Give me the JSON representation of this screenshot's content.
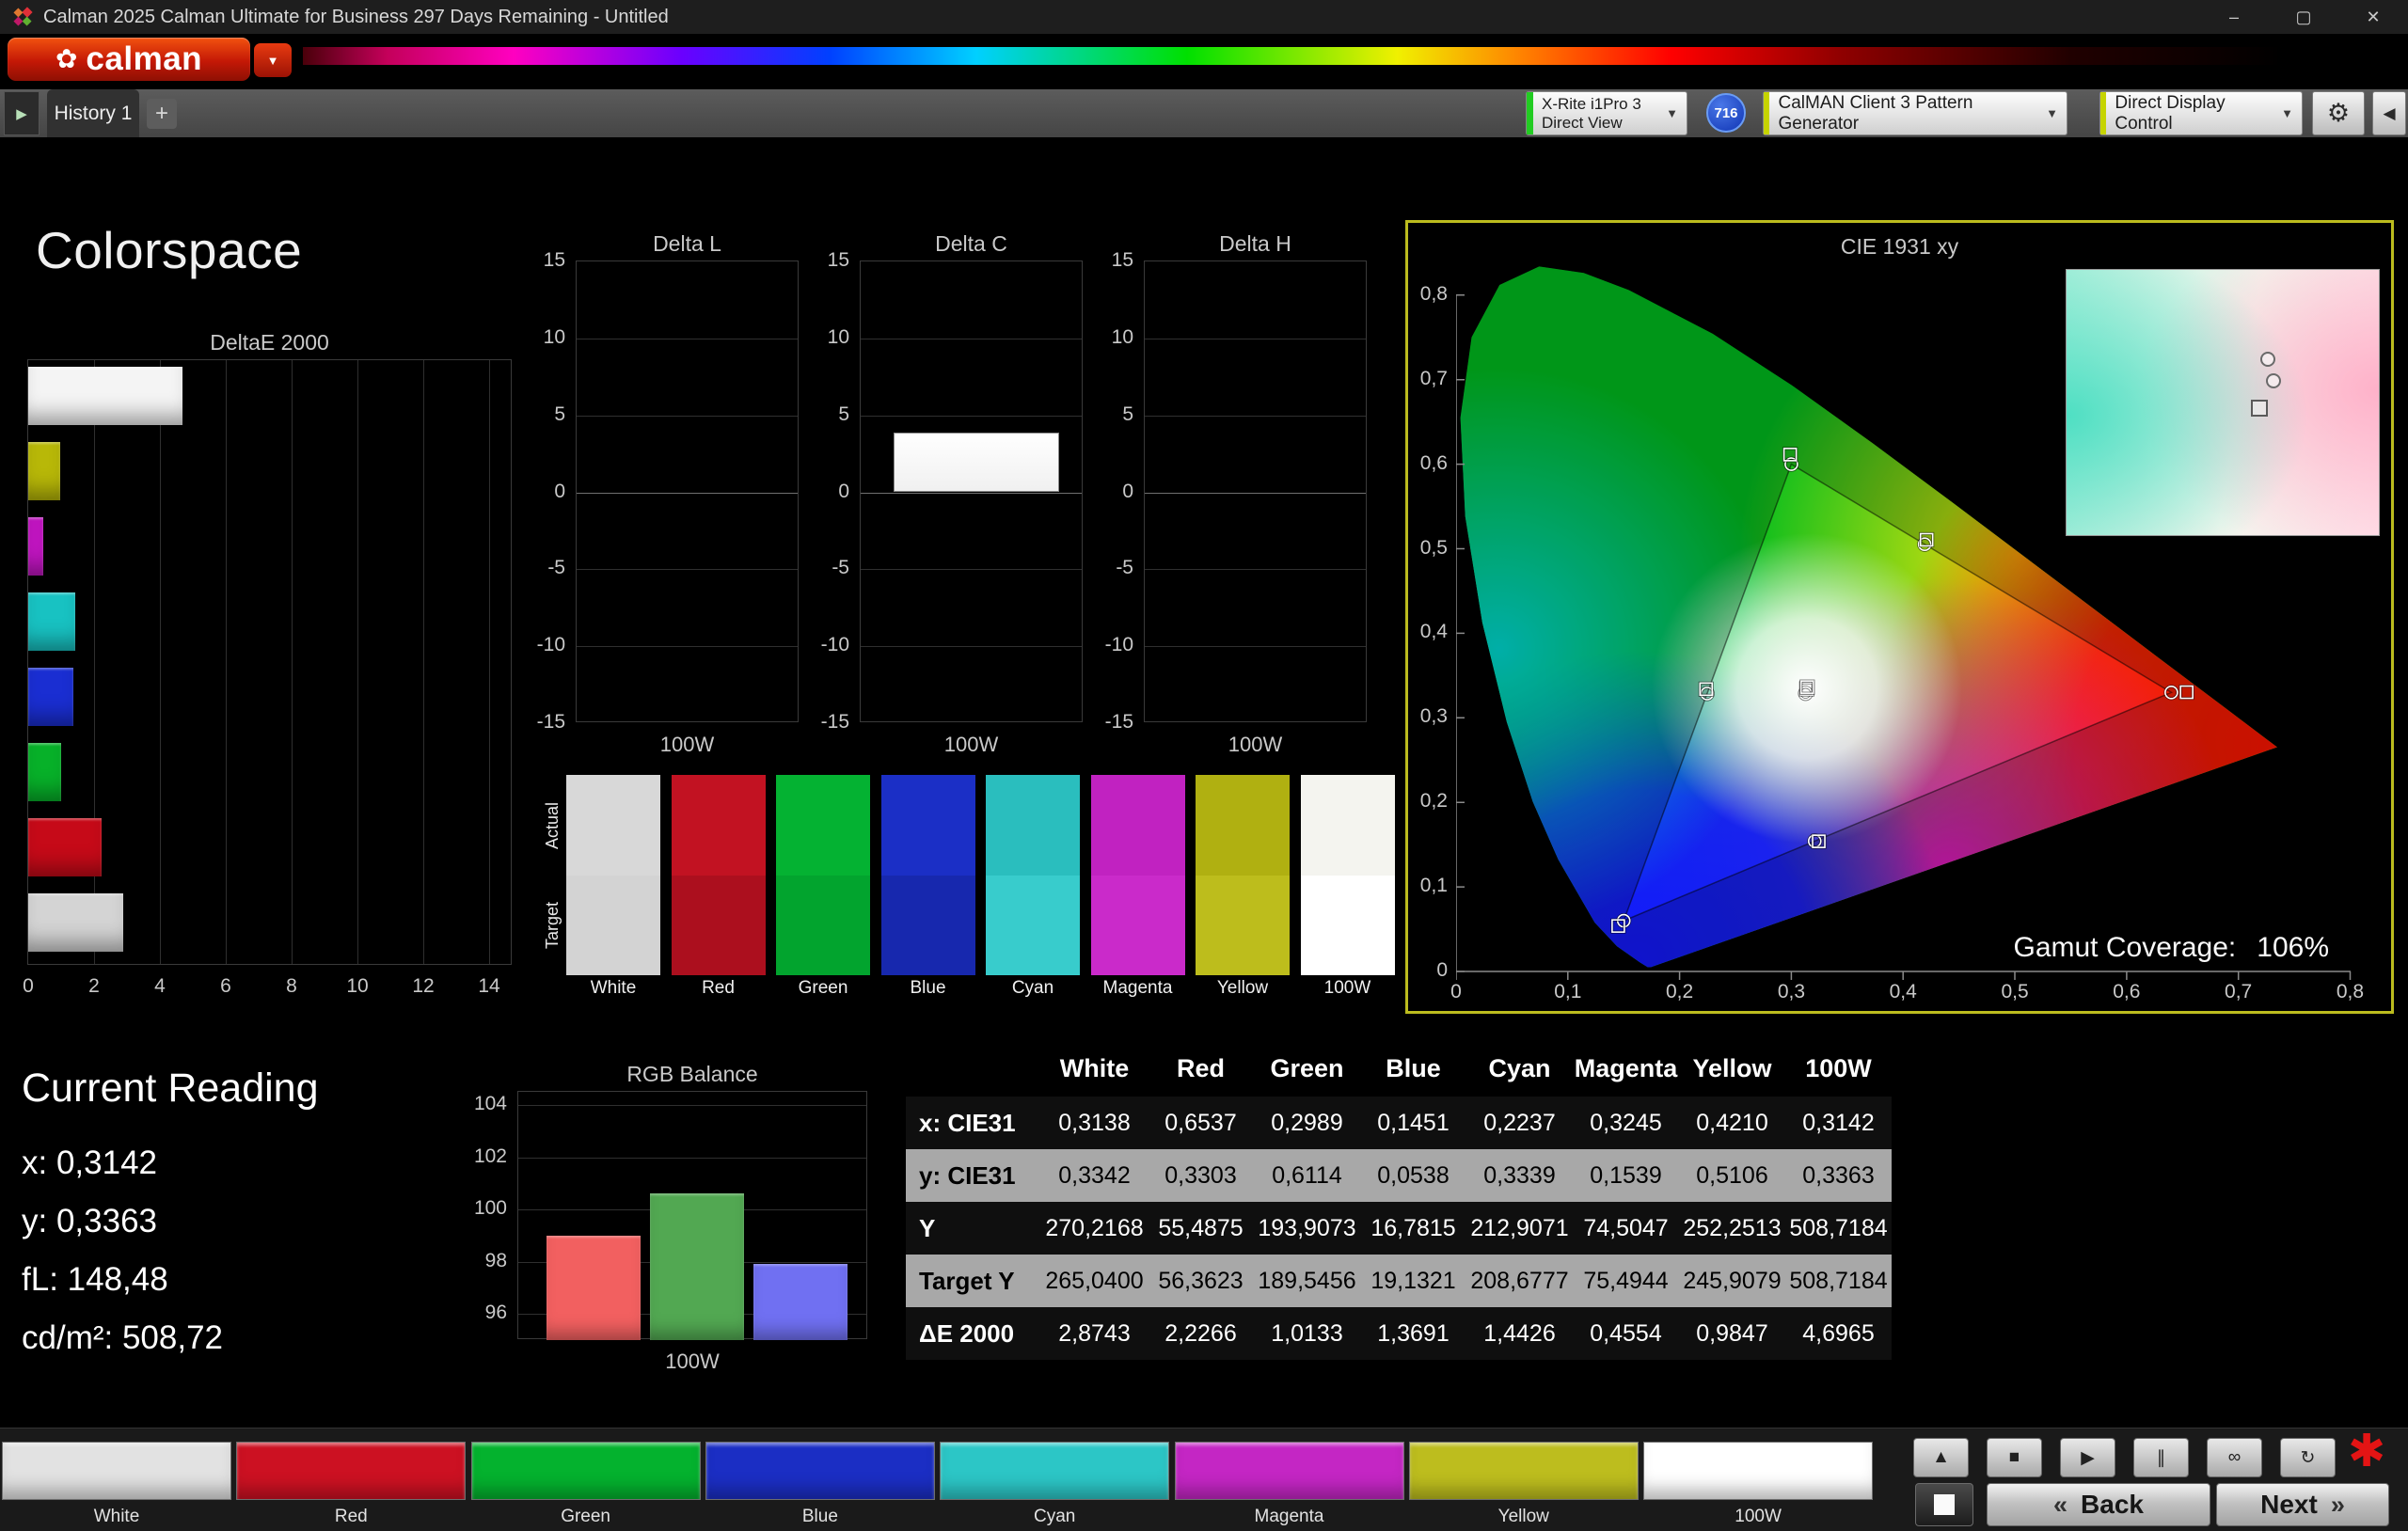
{
  "window": {
    "title": "Calman 2025 Calman Ultimate for Business 297 Days Remaining  - Untitled",
    "minimize_glyph": "–",
    "maximize_glyph": "▢",
    "close_glyph": "✕"
  },
  "brand": {
    "logo_text": "calman",
    "flower_glyph": "✿",
    "caret_glyph": "▼"
  },
  "tabs": {
    "expand_glyph": "▶",
    "history_label": "History 1",
    "add_label": "+"
  },
  "toolbar": {
    "meter": {
      "line1": "X-Rite i1Pro 3",
      "line2": "Direct View",
      "stripe_color": "#22cc22",
      "caret": "▼"
    },
    "badge_value": "716",
    "pattern_generator": {
      "label": "CalMAN Client 3 Pattern Generator",
      "stripe_color": "#c6d400",
      "caret": "▼"
    },
    "display_control": {
      "label": "Direct Display Control",
      "stripe_color": "#c6d400",
      "caret": "▼"
    },
    "settings_glyph": "⚙",
    "collapse_glyph": "◀"
  },
  "page": {
    "title": "Colorspace"
  },
  "current_reading": {
    "title": "Current Reading",
    "lines": [
      "x: 0,3142",
      "y: 0,3363",
      "fL: 148,48",
      "cd/m²: 508,72"
    ]
  },
  "swatches": {
    "row_labels": [
      "Actual",
      "Target"
    ],
    "columns": [
      {
        "label": "White",
        "actual": "#d8d8d8",
        "target": "#d3d3d3"
      },
      {
        "label": "Red",
        "actual": "#c21222",
        "target": "#ac0f1e"
      },
      {
        "label": "Green",
        "actual": "#04b232",
        "target": "#02a42e"
      },
      {
        "label": "Blue",
        "actual": "#1b2fc6",
        "target": "#1728ae"
      },
      {
        "label": "Cyan",
        "actual": "#2abebe",
        "target": "#38cccc"
      },
      {
        "label": "Magenta",
        "actual": "#c122c1",
        "target": "#ca2aca"
      },
      {
        "label": "Yellow",
        "actual": "#b0b011",
        "target": "#bdbd1c"
      },
      {
        "label": "100W",
        "actual": "#f4f4ef",
        "target": "#ffffff"
      }
    ]
  },
  "table": {
    "headers": [
      "",
      "White",
      "Red",
      "Green",
      "Blue",
      "Cyan",
      "Magenta",
      "Yellow",
      "100W"
    ],
    "rows": [
      {
        "label": "x: CIE31",
        "shade": "dark",
        "values": [
          "0,3138",
          "0,6537",
          "0,2989",
          "0,1451",
          "0,2237",
          "0,3245",
          "0,4210",
          "0,3142"
        ]
      },
      {
        "label": "y: CIE31",
        "shade": "light",
        "values": [
          "0,3342",
          "0,3303",
          "0,6114",
          "0,0538",
          "0,3339",
          "0,1539",
          "0,5106",
          "0,3363"
        ]
      },
      {
        "label": "Y",
        "shade": "dark",
        "values": [
          "270,2168",
          "55,4875",
          "193,9073",
          "16,7815",
          "212,9071",
          "74,5047",
          "252,2513",
          "508,7184"
        ]
      },
      {
        "label": "Target Y",
        "shade": "light",
        "values": [
          "265,0400",
          "56,3623",
          "189,5456",
          "19,1321",
          "208,6777",
          "75,4944",
          "245,9079",
          "508,7184"
        ]
      },
      {
        "label": "ΔE 2000",
        "shade": "dark",
        "values": [
          "2,8743",
          "2,2266",
          "1,0133",
          "1,3691",
          "1,4426",
          "0,4554",
          "0,9847",
          "4,6965"
        ]
      }
    ]
  },
  "bottom": {
    "pattern_buttons": [
      {
        "label": "White",
        "color": "#e2e2e2"
      },
      {
        "label": "Red",
        "color": "#cc1122"
      },
      {
        "label": "Green",
        "color": "#04b22e"
      },
      {
        "label": "Blue",
        "color": "#1b2ec4"
      },
      {
        "label": "Cyan",
        "color": "#2cc6c6"
      },
      {
        "label": "Magenta",
        "color": "#c426c4"
      },
      {
        "label": "Yellow",
        "color": "#bdbd1e"
      },
      {
        "label": "100W",
        "color": "#ffffff"
      }
    ],
    "transport": [
      {
        "name": "eject",
        "glyph": "▲"
      },
      {
        "name": "stop",
        "glyph": "■"
      },
      {
        "name": "play",
        "glyph": "▶"
      },
      {
        "name": "pause",
        "glyph": "∥"
      },
      {
        "name": "loop",
        "glyph": "∞"
      },
      {
        "name": "refresh",
        "glyph": "↻"
      }
    ],
    "alert_glyph": "✱",
    "back_chevron": "«",
    "back_label": "Back",
    "next_label": "Next",
    "next_chevron": "»"
  },
  "chart_data": [
    {
      "id": "delta_e_2000",
      "type": "bar",
      "orientation": "horizontal",
      "title": "DeltaE 2000",
      "categories": [
        "100W",
        "Yellow",
        "Magenta",
        "Cyan",
        "Blue",
        "Green",
        "Red",
        "White"
      ],
      "values": [
        4.6965,
        0.9847,
        0.4554,
        1.4426,
        1.3691,
        1.0133,
        2.2266,
        2.8743
      ],
      "colors": [
        "#f4f4f4",
        "#b8b808",
        "#c215c2",
        "#18c2c2",
        "#1a2ed2",
        "#07b129",
        "#c60a18",
        "#d4d4d4"
      ],
      "xlim": [
        0,
        14
      ],
      "xticks": [
        "0",
        "2",
        "4",
        "6",
        "8",
        "10",
        "12",
        "14"
      ],
      "grid": true
    },
    {
      "id": "delta_l",
      "type": "bar",
      "title": "Delta L",
      "categories": [
        "100W"
      ],
      "xlabel": "100W",
      "values": [
        0
      ],
      "ylim": [
        -15,
        15
      ],
      "yticks": [
        "15",
        "10",
        "5",
        "0",
        "-5",
        "-10",
        "-15"
      ],
      "grid": true
    },
    {
      "id": "delta_c",
      "type": "bar",
      "title": "Delta C",
      "categories": [
        "100W"
      ],
      "xlabel": "100W",
      "values": [
        3.9
      ],
      "ylim": [
        -15,
        15
      ],
      "yticks": [
        "15",
        "10",
        "5",
        "0",
        "-5",
        "-10",
        "-15"
      ],
      "bar_color": "#f0f0f0",
      "grid": true
    },
    {
      "id": "delta_h",
      "type": "bar",
      "title": "Delta H",
      "categories": [
        "100W"
      ],
      "xlabel": "100W",
      "values": [
        0
      ],
      "ylim": [
        -15,
        15
      ],
      "yticks": [
        "15",
        "10",
        "5",
        "0",
        "-5",
        "-10",
        "-15"
      ],
      "grid": true
    },
    {
      "id": "rgb_balance",
      "type": "bar",
      "title": "RGB Balance",
      "categories": [
        "Red",
        "Green",
        "Blue"
      ],
      "xlabel": "100W",
      "values": [
        99.0,
        100.6,
        97.9
      ],
      "colors": [
        "#f26060",
        "#52a852",
        "#7070f2"
      ],
      "ylim": [
        95,
        105
      ],
      "yticks": [
        "104",
        "102",
        "100",
        "98",
        "96"
      ],
      "grid": true
    },
    {
      "id": "cie_1931_xy",
      "type": "scatter",
      "title": "CIE 1931 xy",
      "xlim": [
        0,
        0.8
      ],
      "ylim": [
        0,
        0.8
      ],
      "xticks": [
        "0",
        "0,1",
        "0,2",
        "0,3",
        "0,4",
        "0,5",
        "0,6",
        "0,7",
        "0,8"
      ],
      "yticks": [
        "0",
        "0,1",
        "0,2",
        "0,3",
        "0,4",
        "0,5",
        "0,6",
        "0,7",
        "0,8"
      ],
      "gamut_triangle": [
        [
          0.64,
          0.33
        ],
        [
          0.3,
          0.6
        ],
        [
          0.15,
          0.06
        ]
      ],
      "points": [
        {
          "name": "White",
          "x": 0.3138,
          "y": 0.3342
        },
        {
          "name": "Red",
          "x": 0.6537,
          "y": 0.3303
        },
        {
          "name": "Green",
          "x": 0.2989,
          "y": 0.6114
        },
        {
          "name": "Blue",
          "x": 0.1451,
          "y": 0.0538
        },
        {
          "name": "Cyan",
          "x": 0.2237,
          "y": 0.3339
        },
        {
          "name": "Magenta",
          "x": 0.3245,
          "y": 0.1539
        },
        {
          "name": "Yellow",
          "x": 0.421,
          "y": 0.5106
        },
        {
          "name": "100W",
          "x": 0.3142,
          "y": 0.3363
        }
      ],
      "targets": [
        {
          "name": "Red",
          "x": 0.64,
          "y": 0.33
        },
        {
          "name": "Green",
          "x": 0.3,
          "y": 0.6
        },
        {
          "name": "Blue",
          "x": 0.15,
          "y": 0.06
        },
        {
          "name": "Cyan",
          "x": 0.2246,
          "y": 0.3287
        },
        {
          "name": "Magenta",
          "x": 0.3209,
          "y": 0.1542
        },
        {
          "name": "Yellow",
          "x": 0.4193,
          "y": 0.5053
        },
        {
          "name": "White",
          "x": 0.3127,
          "y": 0.329
        }
      ],
      "gamut_coverage_label": "Gamut Coverage:",
      "gamut_coverage_value": "106%"
    }
  ]
}
